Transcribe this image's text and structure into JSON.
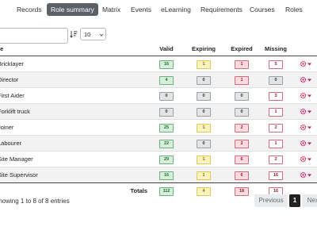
{
  "nav": {
    "tabs": [
      "Records",
      "Role summary",
      "Matrix",
      "Events",
      "eLearning",
      "Requirements",
      "Courses",
      "Roles"
    ],
    "active": "Role summary"
  },
  "controls": {
    "search_value": "",
    "page_size": "10",
    "sort_icon": "sort-numeric-icon"
  },
  "table": {
    "columns": [
      "Role",
      "Valid",
      "Expiring",
      "Expired",
      "Missing"
    ],
    "rows": [
      {
        "role": "Bricklayer",
        "valid": "16",
        "expiring": "1",
        "expired": "1",
        "missing": "5"
      },
      {
        "role": "Director",
        "valid": "4",
        "expiring": "0",
        "expired": "1",
        "missing": "0"
      },
      {
        "role": "First Aider",
        "valid": "0",
        "expiring": "0",
        "expired": "0",
        "missing": "3"
      },
      {
        "role": "Forklift truck",
        "valid": "0",
        "expiring": "0",
        "expired": "0",
        "missing": "1"
      },
      {
        "role": "Joiner",
        "valid": "25",
        "expiring": "1",
        "expired": "2",
        "missing": "2"
      },
      {
        "role": "Labourer",
        "valid": "22",
        "expiring": "0",
        "expired": "2",
        "missing": "1"
      },
      {
        "role": "Site Manager",
        "valid": "29",
        "expiring": "1",
        "expired": "6",
        "missing": "2"
      },
      {
        "role": "Site Supervisor",
        "valid": "16",
        "expiring": "1",
        "expired": "6",
        "missing": "16"
      }
    ],
    "totals": {
      "label": "Totals",
      "valid": "112",
      "expiring": "4",
      "expired": "18",
      "missing": "16"
    }
  },
  "footer": {
    "info": "Showing 1 to 8 of 8 entries",
    "previous": "Previous",
    "current_page": "1",
    "next": "Next"
  },
  "colors": {
    "active_tab": "#5a6268",
    "valid": "#d8efdc",
    "expiring": "#fcf3c4",
    "expired": "#f9dbe0",
    "zero": "#e2e4e6",
    "action_icon": "#c2185b"
  }
}
